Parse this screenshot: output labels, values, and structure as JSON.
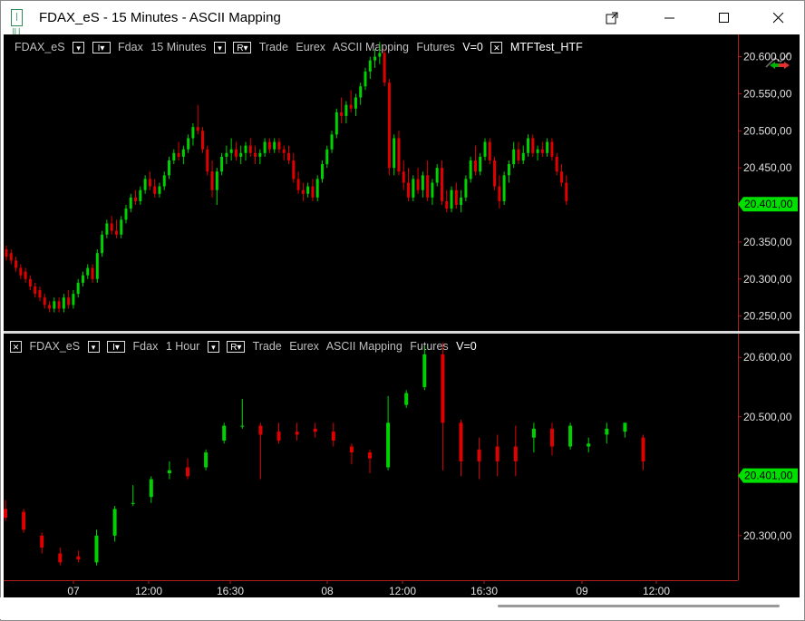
{
  "window": {
    "title": "FDAX_eS - 15 Minutes - ASCII Mapping",
    "app_icon_glyph": "|‖|"
  },
  "top_pane": {
    "symbol": "FDAX_eS",
    "btn_dropdown": "▾",
    "btn_indicator": "I▾",
    "name": "Fdax",
    "interval": "15 Minutes",
    "btn_r": "R▾",
    "type": "Trade",
    "exchange": "Eurex",
    "mapping": "ASCII Mapping",
    "category": "Futures",
    "volume": "V=0",
    "close_btn": "✕",
    "indicator": "MTFTest_HTF",
    "price_labels": [
      "20.600,00",
      "20.550,00",
      "20.500,00",
      "20.450,00",
      "20.400,00",
      "20.350,00",
      "20.300,00",
      "20.250,00"
    ],
    "last_price": "20.401,00",
    "last_value": 20401
  },
  "bottom_pane": {
    "close_btn": "✕",
    "symbol": "FDAX_eS",
    "btn_dropdown": "▾",
    "btn_indicator": "I▾",
    "name": "Fdax",
    "interval": "1 Hour",
    "btn_r": "R▾",
    "type": "Trade",
    "exchange": "Eurex",
    "mapping": "ASCII Mapping",
    "category": "Futures",
    "volume": "V=0",
    "price_labels": [
      "20.600,00",
      "20.500,00",
      "20.400,00",
      "20.300,00"
    ],
    "last_price": "20.401,00",
    "last_value": 20401
  },
  "time_axis": [
    "07",
    "12:00",
    "16:30",
    "08",
    "12:00",
    "16:30",
    "09",
    "12:00"
  ],
  "colors": {
    "up": "#00d200",
    "down": "#e00000",
    "bg": "#000000",
    "text": "#bfbfbf",
    "last_badge": "#00e000"
  },
  "chart_data": [
    {
      "type": "candlestick",
      "title": "FDAX_eS - 15 Minutes",
      "ylim": [
        20230,
        20630
      ],
      "ohlc": [
        [
          20340,
          20345,
          20325,
          20330
        ],
        [
          20335,
          20340,
          20320,
          20325
        ],
        [
          20325,
          20330,
          20310,
          20315
        ],
        [
          20315,
          20320,
          20300,
          20305
        ],
        [
          20310,
          20315,
          20295,
          20300
        ],
        [
          20300,
          20305,
          20285,
          20290
        ],
        [
          20290,
          20295,
          20275,
          20280
        ],
        [
          20285,
          20290,
          20270,
          20275
        ],
        [
          20275,
          20280,
          20260,
          20265
        ],
        [
          20265,
          20270,
          20255,
          20260
        ],
        [
          20260,
          20275,
          20255,
          20270
        ],
        [
          20270,
          20275,
          20255,
          20260
        ],
        [
          20260,
          20280,
          20255,
          20275
        ],
        [
          20275,
          20285,
          20260,
          20265
        ],
        [
          20265,
          20285,
          20260,
          20280
        ],
        [
          20280,
          20300,
          20275,
          20295
        ],
        [
          20295,
          20310,
          20290,
          20305
        ],
        [
          20305,
          20320,
          20300,
          20315
        ],
        [
          20315,
          20320,
          20295,
          20300
        ],
        [
          20300,
          20340,
          20295,
          20335
        ],
        [
          20335,
          20365,
          20330,
          20360
        ],
        [
          20360,
          20380,
          20355,
          20375
        ],
        [
          20375,
          20385,
          20360,
          20365
        ],
        [
          20365,
          20380,
          20355,
          20360
        ],
        [
          20360,
          20385,
          20355,
          20380
        ],
        [
          20380,
          20400,
          20375,
          20395
        ],
        [
          20395,
          20415,
          20390,
          20410
        ],
        [
          20410,
          20420,
          20400,
          20405
        ],
        [
          20405,
          20425,
          20400,
          20420
        ],
        [
          20420,
          20440,
          20415,
          20435
        ],
        [
          20435,
          20445,
          20420,
          20425
        ],
        [
          20425,
          20435,
          20410,
          20415
        ],
        [
          20415,
          20430,
          20410,
          20425
        ],
        [
          20425,
          20445,
          20420,
          20440
        ],
        [
          20440,
          20465,
          20435,
          20460
        ],
        [
          20460,
          20475,
          20455,
          20470
        ],
        [
          20470,
          20485,
          20460,
          20465
        ],
        [
          20465,
          20480,
          20455,
          20475
        ],
        [
          20475,
          20495,
          20470,
          20490
        ],
        [
          20490,
          20510,
          20480,
          20505
        ],
        [
          20505,
          20535,
          20495,
          20500
        ],
        [
          20500,
          20505,
          20470,
          20475
        ],
        [
          20475,
          20480,
          20440,
          20445
        ],
        [
          20445,
          20460,
          20410,
          20420
        ],
        [
          20420,
          20450,
          20400,
          20445
        ],
        [
          20445,
          20470,
          20440,
          20465
        ],
        [
          20465,
          20480,
          20455,
          20470
        ],
        [
          20470,
          20490,
          20460,
          20475
        ],
        [
          20475,
          20485,
          20460,
          20465
        ],
        [
          20465,
          20480,
          20455,
          20470
        ],
        [
          20470,
          20485,
          20460,
          20480
        ],
        [
          20480,
          20490,
          20465,
          20470
        ],
        [
          20470,
          20480,
          20455,
          20465
        ],
        [
          20465,
          20475,
          20455,
          20470
        ],
        [
          20470,
          20490,
          20465,
          20485
        ],
        [
          20485,
          20490,
          20470,
          20475
        ],
        [
          20475,
          20490,
          20470,
          20485
        ],
        [
          20485,
          20490,
          20470,
          20475
        ],
        [
          20475,
          20480,
          20460,
          20470
        ],
        [
          20470,
          20480,
          20455,
          20460
        ],
        [
          20460,
          20470,
          20430,
          20435
        ],
        [
          20435,
          20445,
          20415,
          20420
        ],
        [
          20420,
          20430,
          20405,
          20415
        ],
        [
          20415,
          20430,
          20410,
          20425
        ],
        [
          20425,
          20435,
          20405,
          20410
        ],
        [
          20410,
          20440,
          20405,
          20435
        ],
        [
          20435,
          20460,
          20430,
          20455
        ],
        [
          20455,
          20480,
          20450,
          20475
        ],
        [
          20475,
          20500,
          20470,
          20495
        ],
        [
          20495,
          20530,
          20490,
          20525
        ],
        [
          20525,
          20545,
          20510,
          20520
        ],
        [
          20520,
          20540,
          20510,
          20535
        ],
        [
          20535,
          20555,
          20525,
          20530
        ],
        [
          20530,
          20550,
          20520,
          20545
        ],
        [
          20545,
          20565,
          20535,
          20560
        ],
        [
          20560,
          20585,
          20555,
          20580
        ],
        [
          20580,
          20600,
          20570,
          20595
        ],
        [
          20595,
          20610,
          20585,
          20600
        ],
        [
          20600,
          20620,
          20590,
          20605
        ],
        [
          20605,
          20610,
          20560,
          20565
        ],
        [
          20565,
          20570,
          20440,
          20450
        ],
        [
          20450,
          20495,
          20440,
          20490
        ],
        [
          20490,
          20500,
          20440,
          20445
        ],
        [
          20445,
          20460,
          20420,
          20430
        ],
        [
          20430,
          20450,
          20405,
          20410
        ],
        [
          20410,
          20440,
          20405,
          20435
        ],
        [
          20435,
          20450,
          20415,
          20420
        ],
        [
          20420,
          20445,
          20410,
          20440
        ],
        [
          20440,
          20460,
          20405,
          20410
        ],
        [
          20410,
          20435,
          20400,
          20430
        ],
        [
          20430,
          20455,
          20425,
          20450
        ],
        [
          20450,
          20460,
          20400,
          20405
        ],
        [
          20405,
          20420,
          20390,
          20395
        ],
        [
          20395,
          20425,
          20390,
          20420
        ],
        [
          20420,
          20430,
          20395,
          20400
        ],
        [
          20400,
          20420,
          20390,
          20410
        ],
        [
          20410,
          20440,
          20405,
          20435
        ],
        [
          20435,
          20465,
          20430,
          20460
        ],
        [
          20460,
          20480,
          20440,
          20445
        ],
        [
          20445,
          20470,
          20440,
          20465
        ],
        [
          20465,
          20490,
          20460,
          20485
        ],
        [
          20485,
          20490,
          20455,
          20460
        ],
        [
          20460,
          20465,
          20420,
          20425
        ],
        [
          20425,
          20440,
          20395,
          20405
        ],
        [
          20405,
          20445,
          20400,
          20440
        ],
        [
          20440,
          20460,
          20430,
          20455
        ],
        [
          20455,
          20485,
          20450,
          20475
        ],
        [
          20475,
          20485,
          20455,
          20460
        ],
        [
          20460,
          20480,
          20455,
          20470
        ],
        [
          20470,
          20495,
          20465,
          20490
        ],
        [
          20490,
          20495,
          20465,
          20470
        ],
        [
          20470,
          20480,
          20460,
          20475
        ],
        [
          20475,
          20485,
          20465,
          20470
        ],
        [
          20470,
          20490,
          20465,
          20485
        ],
        [
          20485,
          20490,
          20460,
          20465
        ],
        [
          20465,
          20470,
          20440,
          20445
        ],
        [
          20445,
          20455,
          20425,
          20430
        ],
        [
          20430,
          20440,
          20400,
          20405
        ]
      ]
    },
    {
      "type": "candlestick",
      "title": "FDAX_eS - 1 Hour",
      "ylim": [
        20225,
        20640
      ],
      "ohlc": [
        [
          20345,
          20360,
          20325,
          20330
        ],
        [
          20340,
          20345,
          20305,
          20310
        ],
        [
          20300,
          20305,
          20270,
          20280
        ],
        [
          20270,
          20280,
          20250,
          20255
        ],
        [
          20265,
          20275,
          20255,
          20260
        ],
        [
          20255,
          20310,
          20250,
          20300
        ],
        [
          20300,
          20350,
          20290,
          20345
        ],
        [
          20355,
          20385,
          20350,
          20355
        ],
        [
          20365,
          20400,
          20355,
          20395
        ],
        [
          20405,
          20425,
          20395,
          20410
        ],
        [
          20415,
          20430,
          20395,
          20400
        ],
        [
          20415,
          20445,
          20410,
          20440
        ],
        [
          20460,
          20490,
          20455,
          20485
        ],
        [
          20485,
          20530,
          20480,
          20485
        ],
        [
          20485,
          20490,
          20395,
          20470
        ],
        [
          20475,
          20490,
          20455,
          20460
        ],
        [
          20475,
          20490,
          20460,
          20470
        ],
        [
          20480,
          20490,
          20465,
          20475
        ],
        [
          20475,
          20490,
          20450,
          20460
        ],
        [
          20450,
          20455,
          20420,
          20440
        ],
        [
          20440,
          20445,
          20405,
          20430
        ],
        [
          20415,
          20535,
          20410,
          20490
        ],
        [
          20520,
          20545,
          20515,
          20540
        ],
        [
          20550,
          20620,
          20545,
          20605
        ],
        [
          20605,
          20625,
          20410,
          20490
        ],
        [
          20490,
          20495,
          20400,
          20425
        ],
        [
          20445,
          20465,
          20395,
          20425
        ],
        [
          20450,
          20470,
          20400,
          20425
        ],
        [
          20450,
          20485,
          20400,
          20425
        ],
        [
          20465,
          20490,
          20440,
          20480
        ],
        [
          20480,
          20490,
          20435,
          20450
        ],
        [
          20450,
          20490,
          20445,
          20485
        ],
        [
          20450,
          20465,
          20440,
          20455
        ],
        [
          20470,
          20490,
          20455,
          20480
        ],
        [
          20475,
          20490,
          20465,
          20490
        ],
        [
          20465,
          20470,
          20410,
          20425
        ]
      ]
    }
  ]
}
